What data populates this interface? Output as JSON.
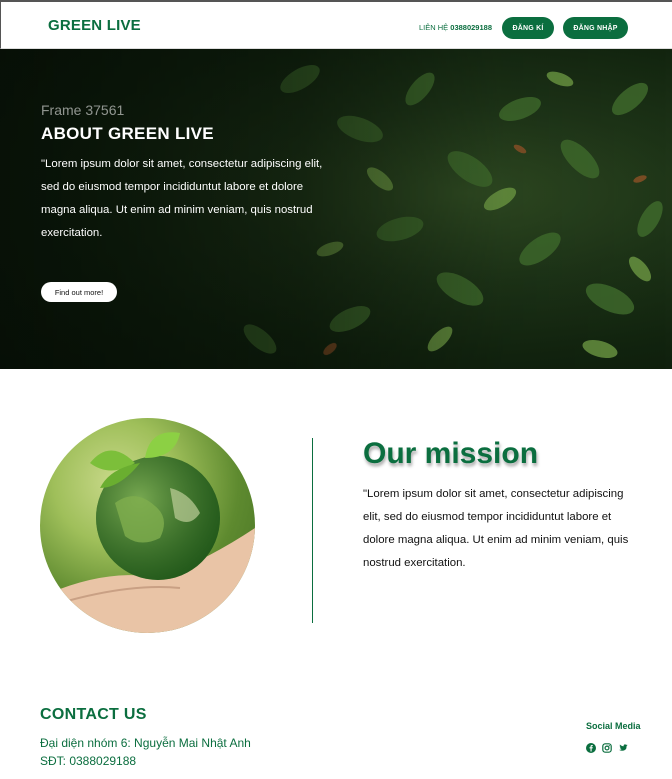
{
  "header": {
    "logo": "GREEN LIVE",
    "contact_label": "LIÊN HỆ",
    "contact_phone": "0388029188",
    "register_button": "ĐĂNG KÍ",
    "login_button": "ĐĂNG NHẬP"
  },
  "hero": {
    "frame_label": "Frame 37561",
    "title": "ABOUT GREEN LIVE",
    "text": "\"Lorem ipsum dolor sit amet, consectetur adipiscing elit, sed do eiusmod tempor incididuntut labore et dolore magna aliqua. Ut enim ad minim veniam, quis nostrud exercitation.",
    "button": "Find out more!"
  },
  "mission": {
    "title": "Our mission",
    "text": "\"Lorem ipsum dolor sit amet, consectetur adipiscing elit, sed do eiusmod tempor incididuntut labore et dolore magna aliqua. Ut enim ad minim veniam, quis nostrud exercitation."
  },
  "footer": {
    "contact_title": "CONTACT US",
    "representative": "Đại diện nhóm 6: Nguyễn Mai Nhật Anh",
    "phone": "SĐT: 0388029188",
    "social_title": "Social Media",
    "social_icons": [
      "facebook-icon",
      "instagram-icon",
      "twitter-icon"
    ]
  },
  "colors": {
    "brand_green": "#0b6e3f",
    "hero_dark": "#12240f",
    "white": "#ffffff"
  }
}
